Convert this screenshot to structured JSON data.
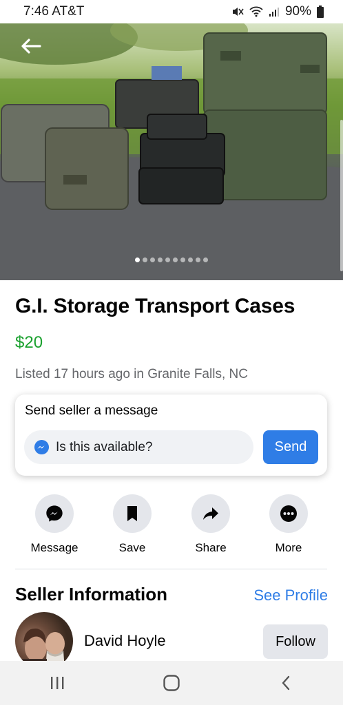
{
  "status_bar": {
    "time": "7:46",
    "carrier": "AT&T",
    "battery": "90%"
  },
  "hero": {
    "image_count": 10,
    "active_index": 0
  },
  "listing": {
    "title": "G.I. Storage Transport Cases",
    "price": "$20",
    "listed_text": "Listed 17 hours ago in Granite Falls, NC"
  },
  "message_card": {
    "title": "Send seller a message",
    "input_value": "Is this available?",
    "send_label": "Send"
  },
  "actions": [
    {
      "label": "Message",
      "icon": "messenger-icon"
    },
    {
      "label": "Save",
      "icon": "bookmark-icon"
    },
    {
      "label": "Share",
      "icon": "share-icon"
    },
    {
      "label": "More",
      "icon": "more-icon"
    }
  ],
  "seller": {
    "section_title": "Seller Information",
    "see_profile_label": "See Profile",
    "name": "David Hoyle",
    "follow_label": "Follow"
  },
  "colors": {
    "price": "#1ba12f",
    "accent": "#2f7de6",
    "secondary_text": "#65676b"
  }
}
